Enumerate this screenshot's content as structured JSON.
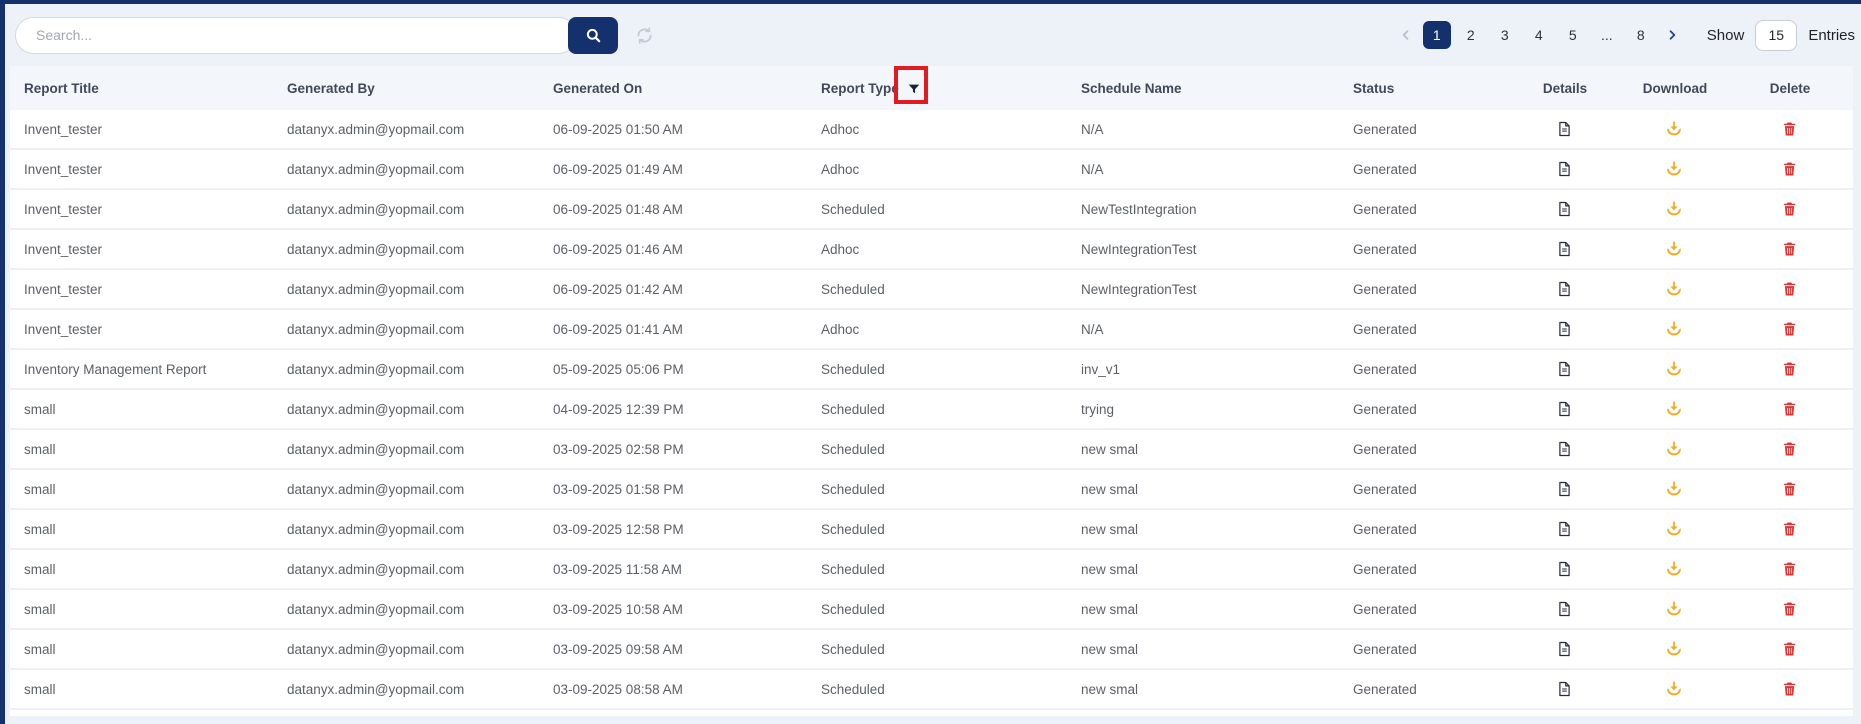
{
  "toolbar": {
    "search_placeholder": "Search...",
    "show_label": "Show",
    "entries_value": "15",
    "entries_label": "Entries"
  },
  "pagination": {
    "pages": [
      "1",
      "2",
      "3",
      "4",
      "5",
      "...",
      "8"
    ],
    "active_page": "1",
    "prev_icon": "chevron-left",
    "next_icon": "chevron-right"
  },
  "table": {
    "columns": [
      "Report Title",
      "Generated By",
      "Generated On",
      "Report Type",
      "Schedule Name",
      "Status",
      "Details",
      "Download",
      "Delete"
    ],
    "rows": [
      {
        "title": "Invent_tester",
        "generated_by": "datanyx.admin@yopmail.com",
        "generated_on": "06-09-2025 01:50 AM",
        "report_type": "Adhoc",
        "schedule_name": "N/A",
        "status": "Generated"
      },
      {
        "title": "Invent_tester",
        "generated_by": "datanyx.admin@yopmail.com",
        "generated_on": "06-09-2025 01:49 AM",
        "report_type": "Adhoc",
        "schedule_name": "N/A",
        "status": "Generated"
      },
      {
        "title": "Invent_tester",
        "generated_by": "datanyx.admin@yopmail.com",
        "generated_on": "06-09-2025 01:48 AM",
        "report_type": "Scheduled",
        "schedule_name": "NewTestIntegration",
        "status": "Generated"
      },
      {
        "title": "Invent_tester",
        "generated_by": "datanyx.admin@yopmail.com",
        "generated_on": "06-09-2025 01:46 AM",
        "report_type": "Adhoc",
        "schedule_name": "NewIntegrationTest",
        "status": "Generated"
      },
      {
        "title": "Invent_tester",
        "generated_by": "datanyx.admin@yopmail.com",
        "generated_on": "06-09-2025 01:42 AM",
        "report_type": "Scheduled",
        "schedule_name": "NewIntegrationTest",
        "status": "Generated"
      },
      {
        "title": "Invent_tester",
        "generated_by": "datanyx.admin@yopmail.com",
        "generated_on": "06-09-2025 01:41 AM",
        "report_type": "Adhoc",
        "schedule_name": "N/A",
        "status": "Generated"
      },
      {
        "title": "Inventory Management Report",
        "generated_by": "datanyx.admin@yopmail.com",
        "generated_on": "05-09-2025 05:06 PM",
        "report_type": "Scheduled",
        "schedule_name": "inv_v1",
        "status": "Generated"
      },
      {
        "title": "small",
        "generated_by": "datanyx.admin@yopmail.com",
        "generated_on": "04-09-2025 12:39 PM",
        "report_type": "Scheduled",
        "schedule_name": "trying",
        "status": "Generated"
      },
      {
        "title": "small",
        "generated_by": "datanyx.admin@yopmail.com",
        "generated_on": "03-09-2025 02:58 PM",
        "report_type": "Scheduled",
        "schedule_name": "new smal",
        "status": "Generated"
      },
      {
        "title": "small",
        "generated_by": "datanyx.admin@yopmail.com",
        "generated_on": "03-09-2025 01:58 PM",
        "report_type": "Scheduled",
        "schedule_name": "new smal",
        "status": "Generated"
      },
      {
        "title": "small",
        "generated_by": "datanyx.admin@yopmail.com",
        "generated_on": "03-09-2025 12:58 PM",
        "report_type": "Scheduled",
        "schedule_name": "new smal",
        "status": "Generated"
      },
      {
        "title": "small",
        "generated_by": "datanyx.admin@yopmail.com",
        "generated_on": "03-09-2025 11:58 AM",
        "report_type": "Scheduled",
        "schedule_name": "new smal",
        "status": "Generated"
      },
      {
        "title": "small",
        "generated_by": "datanyx.admin@yopmail.com",
        "generated_on": "03-09-2025 10:58 AM",
        "report_type": "Scheduled",
        "schedule_name": "new smal",
        "status": "Generated"
      },
      {
        "title": "small",
        "generated_by": "datanyx.admin@yopmail.com",
        "generated_on": "03-09-2025 09:58 AM",
        "report_type": "Scheduled",
        "schedule_name": "new smal",
        "status": "Generated"
      },
      {
        "title": "small",
        "generated_by": "datanyx.admin@yopmail.com",
        "generated_on": "03-09-2025 08:58 AM",
        "report_type": "Scheduled",
        "schedule_name": "new smal",
        "status": "Generated"
      }
    ]
  },
  "icons": {
    "search": "magnifier-icon",
    "refresh": "refresh-icon",
    "report_type_filter": "filter-funnel-icon",
    "details": "document-icon",
    "download": "download-tray-icon",
    "delete": "trash-icon"
  },
  "colors": {
    "accent_navy": "#15316d",
    "page_background": "#edf1f8",
    "download_amber": "#f1ae2b",
    "delete_red": "#e23434",
    "annotation_red": "#e11b22"
  }
}
